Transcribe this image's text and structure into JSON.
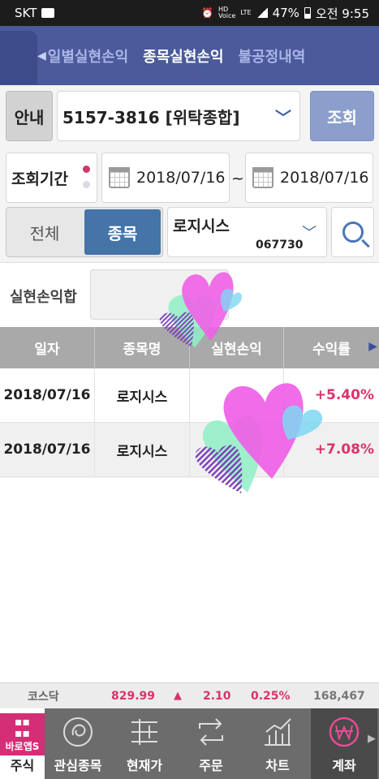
{
  "status_bar": {
    "carrier": "SKT",
    "battery": "47%",
    "time": "오전 9:55",
    "tiny_labels": [
      "HD",
      "Voice",
      "LTE"
    ]
  },
  "header": {
    "tabs": [
      {
        "label": "일별실현손익",
        "active": false
      },
      {
        "label": "종목실현손익",
        "active": true
      },
      {
        "label": "불공정내역",
        "active": false
      }
    ]
  },
  "form": {
    "guide_label": "안내",
    "account": "5157-3816 [위탁종합]",
    "query_label": "조회",
    "period_label": "조회기간",
    "date_from": "2018/07/16",
    "date_sep": "~",
    "date_to": "2018/07/16",
    "scope_options": [
      {
        "label": "전체",
        "active": false
      },
      {
        "label": "종목",
        "active": true
      }
    ],
    "stock_name": "로지시스",
    "stock_code": "067730"
  },
  "summary": {
    "label": "실현손익합",
    "value": ""
  },
  "table": {
    "columns": [
      "일자",
      "종목명",
      "실현손익",
      "수익률"
    ],
    "rows": [
      {
        "date": "2018/07/16",
        "name": "로지시스",
        "pnl": "",
        "rate": "+5.40%"
      },
      {
        "date": "2018/07/16",
        "name": "로지시스",
        "pnl": "",
        "rate": "+7.08%"
      }
    ]
  },
  "ticker": {
    "index": "코스닥",
    "value": "829.99",
    "arrow": "▲",
    "change": "2.10",
    "percent": "0.25%",
    "volume": "168,467"
  },
  "nav": {
    "logo_text": "바로앱S",
    "items": [
      {
        "label": "주식",
        "icon": "grid-logo-icon"
      },
      {
        "label": "관심종목",
        "icon": "star-circle-icon"
      },
      {
        "label": "현재가",
        "icon": "price-lines-icon"
      },
      {
        "label": "주문",
        "icon": "order-arrows-icon"
      },
      {
        "label": "차트",
        "icon": "chart-icon"
      },
      {
        "label": "계좌",
        "icon": "won-circle-icon"
      }
    ]
  },
  "colors": {
    "header": "#4a5a9a",
    "accent_blue": "#4474a8",
    "rise_red": "#d9336b",
    "logo_pink": "#d62d77"
  }
}
